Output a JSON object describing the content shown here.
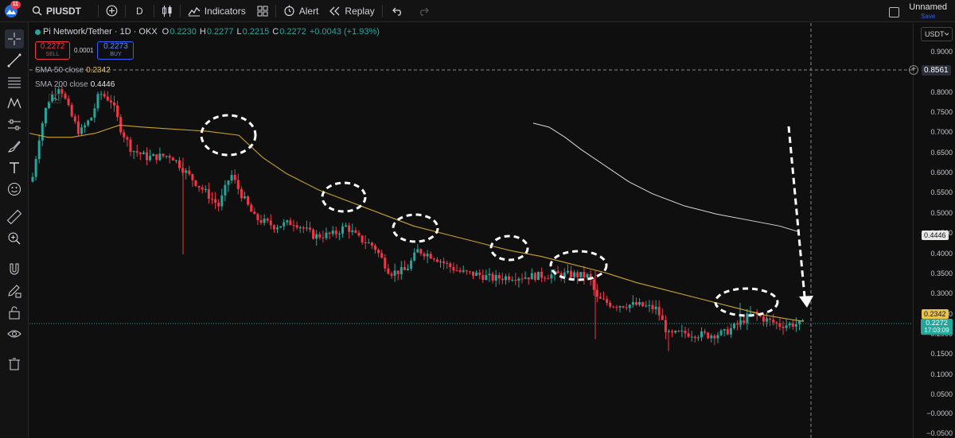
{
  "toolbar": {
    "badge": "11",
    "symbol": "PIUSDT",
    "interval": "D",
    "indicators": "Indicators",
    "alert": "Alert",
    "replay": "Replay",
    "layout_title": "Unnamed",
    "layout_save": "Save"
  },
  "legend": {
    "title": "Pi Network/Tether · 1D · OKX",
    "open_label": "O",
    "open": "0.2230",
    "high_label": "H",
    "high": "0.2277",
    "low_label": "L",
    "low": "0.2215",
    "close_label": "C",
    "close": "0.2272",
    "change": "+0.0043 (+1.93%)"
  },
  "trade": {
    "sell_price": "0.2272",
    "sell_label": "SELL",
    "spread": "0.0001",
    "buy_price": "0.2273",
    "buy_label": "BUY"
  },
  "indicators": {
    "sma50_label": "SMA 50 close",
    "sma50_value": "0.2342",
    "sma200_label": "SMA 200 close",
    "sma200_value": "0.4446"
  },
  "price_axis": {
    "currency": "USDT",
    "ticks": [
      "0.9000",
      "0.8000",
      "0.7500",
      "0.7000",
      "0.6500",
      "0.6000",
      "0.5500",
      "0.5000",
      "0.4500",
      "0.4000",
      "0.3500",
      "0.3000",
      "0.2500",
      "0.2000",
      "0.1500",
      "0.1000",
      "0.0500",
      "−0.0000",
      "−0.0500"
    ],
    "crosshair_price": "0.8561",
    "sma200_tag": "0.4446",
    "sma50_tag": "0.2342",
    "last_price_tag": "0.2272",
    "countdown": "17:03:09"
  },
  "colors": {
    "up": "#26a69a",
    "down": "#f23645",
    "sma50": "#c9a227",
    "sma200": "#d9d9d9"
  },
  "chart_data": {
    "type": "candlestick",
    "ylim": [
      -0.05,
      0.9
    ],
    "grid": false,
    "sma50_path": [
      [
        0.68
      ],
      [
        0.7
      ],
      [
        0.72
      ],
      [
        0.71
      ],
      [
        0.7
      ],
      [
        0.69
      ],
      [
        0.67
      ],
      [
        0.64
      ],
      [
        0.61
      ],
      [
        0.58
      ],
      [
        0.56
      ],
      [
        0.54
      ],
      [
        0.52
      ],
      [
        0.5
      ],
      [
        0.48
      ],
      [
        0.465
      ],
      [
        0.45
      ],
      [
        0.43
      ],
      [
        0.41
      ],
      [
        0.395
      ],
      [
        0.38
      ],
      [
        0.365
      ],
      [
        0.35
      ],
      [
        0.33
      ],
      [
        0.31
      ],
      [
        0.29
      ],
      [
        0.27
      ],
      [
        0.255
      ],
      [
        0.24
      ],
      [
        0.234
      ]
    ],
    "sma200_path": [
      [
        0.72
      ],
      [
        0.7
      ],
      [
        0.66
      ],
      [
        0.62
      ],
      [
        0.58
      ],
      [
        0.55
      ],
      [
        0.52
      ],
      [
        0.5
      ],
      [
        0.485
      ],
      [
        0.47
      ],
      [
        0.46
      ],
      [
        0.445
      ]
    ],
    "annotations": [
      "highlighted swing highs along SMA 50",
      "downward dashed arrow"
    ]
  }
}
